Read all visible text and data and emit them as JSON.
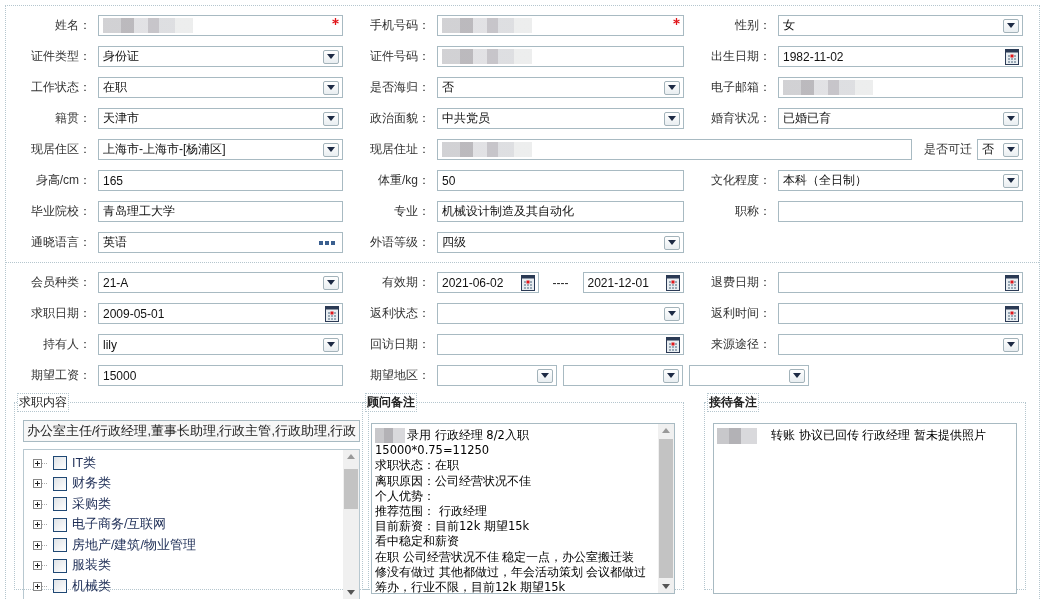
{
  "sections": [
    {
      "rows": [
        {
          "cells": [
            {
              "label": "姓名：",
              "controls": [
                {
                  "kind": "text",
                  "redacted": true,
                  "required": true
                }
              ]
            },
            {
              "label": "手机号码：",
              "controls": [
                {
                  "kind": "text",
                  "redacted": true,
                  "required": true
                }
              ]
            },
            {
              "label": "性别：",
              "controls": [
                {
                  "kind": "select",
                  "value": "女"
                }
              ]
            }
          ]
        },
        {
          "cells": [
            {
              "label": "证件类型：",
              "controls": [
                {
                  "kind": "select",
                  "value": "身份证"
                }
              ]
            },
            {
              "label": "证件号码：",
              "controls": [
                {
                  "kind": "text",
                  "redacted": true
                }
              ]
            },
            {
              "label": "出生日期：",
              "controls": [
                {
                  "kind": "date",
                  "value": "1982-11-02"
                }
              ]
            }
          ]
        },
        {
          "cells": [
            {
              "label": "工作状态：",
              "controls": [
                {
                  "kind": "select",
                  "value": "在职"
                }
              ]
            },
            {
              "label": "是否海归：",
              "controls": [
                {
                  "kind": "select",
                  "value": "否"
                }
              ]
            },
            {
              "label": "电子邮箱：",
              "controls": [
                {
                  "kind": "text",
                  "redacted": true
                }
              ]
            }
          ]
        },
        {
          "cells": [
            {
              "label": "籍贯：",
              "controls": [
                {
                  "kind": "select",
                  "value": "天津市"
                }
              ]
            },
            {
              "label": "政治面貌：",
              "controls": [
                {
                  "kind": "select",
                  "value": "中共党员"
                }
              ]
            },
            {
              "label": "婚育状况：",
              "controls": [
                {
                  "kind": "select",
                  "value": "已婚已育"
                }
              ]
            }
          ]
        },
        {
          "cells": [
            {
              "label": "现居住区：",
              "controls": [
                {
                  "kind": "select",
                  "value": "上海市-上海市-[杨浦区]"
                }
              ]
            },
            {
              "label": "现居住址：",
              "controls": [
                {
                  "kind": "text",
                  "redacted": true
                }
              ],
              "trailing": {
                "label": "是否可迁",
                "control": {
                  "kind": "select",
                  "value": "否"
                }
              }
            }
          ]
        },
        {
          "cells": [
            {
              "label": "身高/cm：",
              "controls": [
                {
                  "kind": "text",
                  "value": "165"
                }
              ]
            },
            {
              "label": "体重/kg：",
              "controls": [
                {
                  "kind": "text",
                  "value": "50"
                }
              ]
            },
            {
              "label": "文化程度：",
              "controls": [
                {
                  "kind": "select",
                  "value": "本科（全日制）"
                }
              ]
            }
          ]
        },
        {
          "cells": [
            {
              "label": "毕业院校：",
              "controls": [
                {
                  "kind": "text",
                  "value": "青岛理工大学"
                }
              ]
            },
            {
              "label": "专业：",
              "controls": [
                {
                  "kind": "text",
                  "value": "机械设计制造及其自动化"
                }
              ]
            },
            {
              "label": "职称：",
              "controls": [
                {
                  "kind": "text"
                }
              ]
            }
          ]
        },
        {
          "cells": [
            {
              "label": "通晓语言：",
              "controls": [
                {
                  "kind": "lookup",
                  "value": "英语"
                }
              ]
            },
            {
              "label": "外语等级：",
              "controls": [
                {
                  "kind": "select",
                  "value": "四级"
                }
              ]
            }
          ]
        }
      ]
    },
    {
      "rows": [
        {
          "cells": [
            {
              "label": "会员种类：",
              "controls": [
                {
                  "kind": "select",
                  "value": "21-A"
                }
              ]
            },
            {
              "label": "有效期：",
              "controls": [
                {
                  "kind": "date",
                  "value": "2021-06-02"
                },
                {
                  "kind": "separator",
                  "value": "----"
                },
                {
                  "kind": "date",
                  "value": "2021-12-01"
                }
              ]
            },
            {
              "label": "退费日期：",
              "controls": [
                {
                  "kind": "date"
                }
              ]
            }
          ]
        },
        {
          "cells": [
            {
              "label": "求职日期：",
              "controls": [
                {
                  "kind": "date",
                  "value": "2009-05-01"
                }
              ]
            },
            {
              "label": "返利状态：",
              "controls": [
                {
                  "kind": "select"
                }
              ]
            },
            {
              "label": "返利时间：",
              "controls": [
                {
                  "kind": "date"
                }
              ]
            }
          ]
        },
        {
          "cells": [
            {
              "label": "持有人：",
              "controls": [
                {
                  "kind": "select",
                  "value": "lily"
                }
              ]
            },
            {
              "label": "回访日期：",
              "controls": [
                {
                  "kind": "date"
                }
              ]
            },
            {
              "label": "来源途径：",
              "controls": [
                {
                  "kind": "select"
                }
              ]
            }
          ]
        },
        {
          "cells": [
            {
              "label": "期望工资：",
              "controls": [
                {
                  "kind": "text",
                  "value": "15000"
                }
              ]
            },
            {
              "label": "期望地区：",
              "controls": [
                {
                  "kind": "select"
                },
                {
                  "kind": "select"
                },
                {
                  "kind": "select"
                }
              ]
            }
          ]
        }
      ]
    }
  ],
  "job_panel": {
    "legend": "求职内容",
    "summary": "办公室主任/行政经理,董事长助理,行政主管,行政助理,行政",
    "tree": [
      {
        "label": "IT类",
        "expanded": false,
        "checked": false
      },
      {
        "label": "财务类",
        "expanded": false,
        "checked": false
      },
      {
        "label": "采购类",
        "expanded": false,
        "checked": false
      },
      {
        "label": "电子商务/互联网",
        "expanded": false,
        "checked": false
      },
      {
        "label": "房地产/建筑/物业管理",
        "expanded": false,
        "checked": false
      },
      {
        "label": "服装类",
        "expanded": false,
        "checked": false
      },
      {
        "label": "机械类",
        "expanded": false,
        "checked": false
      }
    ]
  },
  "notes": [
    {
      "legend": "顾问备注",
      "lines": [
        {
          "text": "录用 行政经理  8/2入职",
          "redacted_prefix": true
        },
        {
          "text": "15000*0.75=11250",
          "redacted_prefix": false
        },
        {
          "text": "求职状态：在职",
          "redacted_prefix": false
        },
        {
          "text": "离职原因：公司经营状况不佳",
          "redacted_prefix": false
        },
        {
          "text": "个人优势：",
          "redacted_prefix": false
        },
        {
          "text": "推荐范围：  行政经理",
          "redacted_prefix": false
        },
        {
          "text": "目前薪资：目前12k 期望15k",
          "redacted_prefix": false
        },
        {
          "text": "看中稳定和薪资",
          "redacted_prefix": false
        },
        {
          "text": "在职 公司经营状况不佳   稳定一点，办公室搬迁装",
          "redacted_prefix": false
        },
        {
          "text": "修没有做过 其他都做过，年会活动策划 会议都做过",
          "redacted_prefix": false
        },
        {
          "text": "筹办，行业不限，目前12k 期望15k",
          "redacted_prefix": false
        }
      ]
    },
    {
      "legend": "接待备注",
      "lines": [
        {
          "text": "转账 协议已回传   行政经理 暂未提供照片",
          "redacted_prefix": true
        }
      ]
    }
  ]
}
